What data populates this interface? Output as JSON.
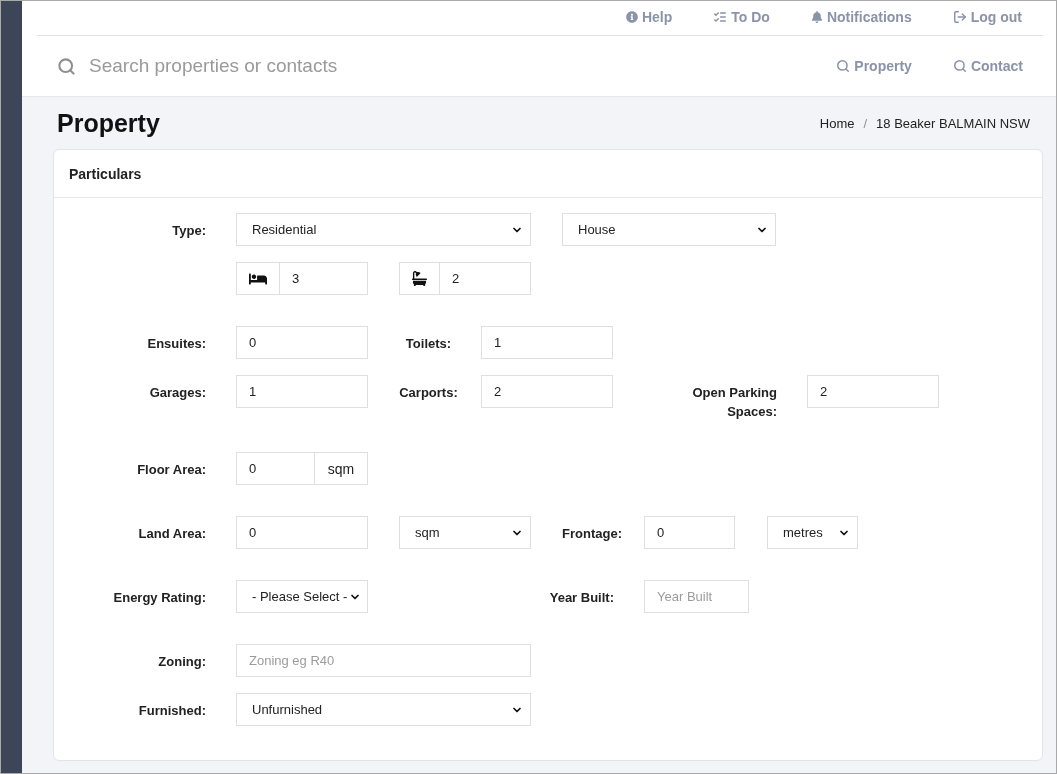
{
  "top_nav": [
    "Help",
    "To Do",
    "Notifications",
    "Log out"
  ],
  "search": {
    "placeholder": "Search properties or contacts",
    "scopes": [
      "Property",
      "Contact"
    ]
  },
  "page_header": {
    "title": "Property",
    "breadcrumb": {
      "items": [
        "Home",
        "18 Beaker BALMAIN NSW"
      ],
      "separator": "/"
    }
  },
  "particulars": {
    "title": "Particulars",
    "rows": [
      {
        "fields": [
          {
            "label": "Type:",
            "control": {
              "kind": "select",
              "value": "Residential"
            }
          },
          {
            "control": {
              "kind": "select",
              "value": "House"
            }
          }
        ]
      },
      {
        "fields": [
          {
            "control": {
              "kind": "icon_input",
              "value": "3"
            }
          },
          {
            "control": {
              "kind": "icon_input",
              "value": "2"
            }
          }
        ]
      },
      {
        "fields": [
          {
            "label": "Ensuites:",
            "control": {
              "kind": "input",
              "value": "0"
            }
          },
          {
            "label": "Toilets:",
            "control": {
              "kind": "input",
              "value": "1"
            }
          }
        ]
      },
      {
        "fields": [
          {
            "label": "Garages:",
            "control": {
              "kind": "input",
              "value": "1"
            }
          },
          {
            "label": "Carports:",
            "control": {
              "kind": "input",
              "value": "2"
            }
          },
          {
            "label": "Open Parking Spaces:",
            "control": {
              "kind": "input",
              "value": "2"
            }
          }
        ]
      },
      {
        "fields": [
          {
            "label": "Floor Area:",
            "control": {
              "kind": "unit_input",
              "value": "0",
              "unit": "sqm"
            }
          }
        ]
      },
      {
        "fields": [
          {
            "label": "Land Area:",
            "control": {
              "kind": "input",
              "value": "0"
            }
          },
          {
            "control": {
              "kind": "select",
              "value": "sqm"
            }
          },
          {
            "label": "Frontage:",
            "control": {
              "kind": "input",
              "value": "0"
            }
          },
          {
            "control": {
              "kind": "select",
              "value": "metres"
            }
          }
        ]
      },
      {
        "fields": [
          {
            "label": "Energy Rating:",
            "control": {
              "kind": "select",
              "value": "- Please Select -"
            }
          },
          {
            "label": "Year Built:",
            "control": {
              "kind": "input",
              "placeholder": "Year Built"
            }
          }
        ]
      },
      {
        "fields": [
          {
            "label": "Zoning:",
            "control": {
              "kind": "input",
              "placeholder": "Zoning eg R40"
            }
          }
        ]
      },
      {
        "fields": [
          {
            "label": "Furnished:",
            "control": {
              "kind": "select",
              "value": "Unfurnished"
            }
          }
        ]
      }
    ]
  }
}
